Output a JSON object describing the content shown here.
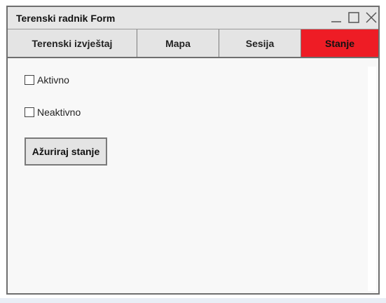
{
  "window": {
    "title": "Terenski radnik Form"
  },
  "titlebar_controls": {
    "minimize_icon": "minimize-icon",
    "maximize_icon": "maximize-icon",
    "close_icon": "close-icon"
  },
  "tabs": [
    {
      "label": "Terenski izvještaj",
      "active": false
    },
    {
      "label": "Mapa",
      "active": false
    },
    {
      "label": "Sesija",
      "active": false
    },
    {
      "label": "Stanje",
      "active": true
    }
  ],
  "colors": {
    "active_tab": "#ee1c25"
  },
  "status": {
    "active_label": "Aktivno",
    "active_checked": false,
    "inactive_label": "Neaktivno",
    "inactive_checked": false,
    "update_button_label": "Ažuriraj stanje"
  }
}
